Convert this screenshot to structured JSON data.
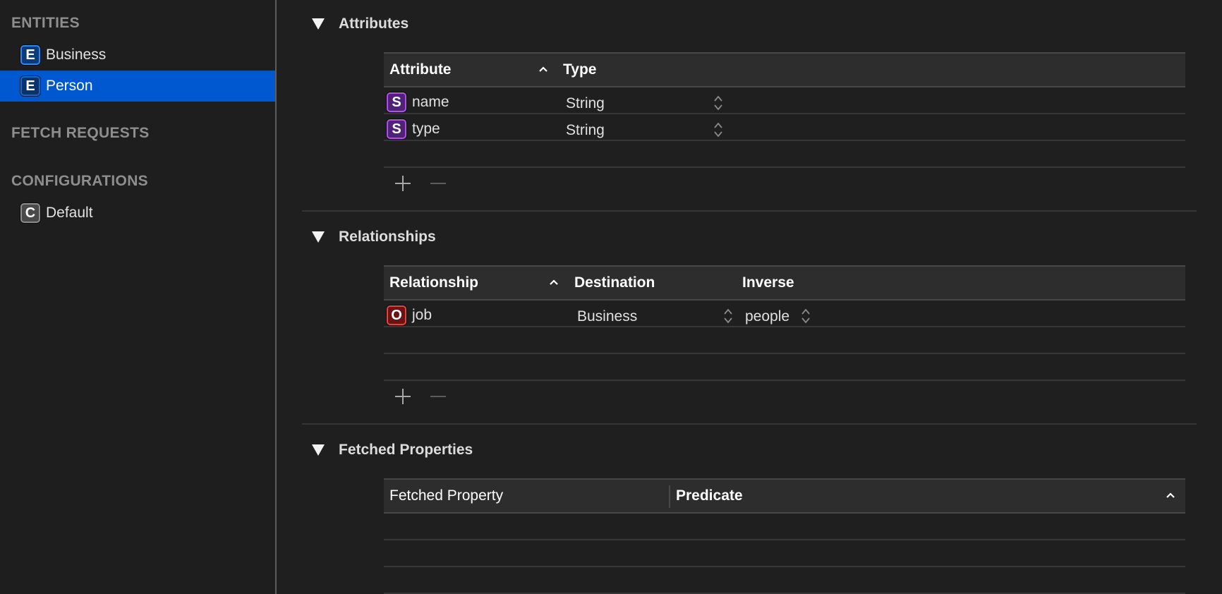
{
  "sidebar": {
    "groups": {
      "entities": "ENTITIES",
      "fetch_requests": "FETCH REQUESTS",
      "configurations": "CONFIGURATIONS"
    },
    "entities": [
      {
        "badge": "E",
        "label": "Business",
        "selected": false
      },
      {
        "badge": "E",
        "label": "Person",
        "selected": true
      }
    ],
    "configurations": [
      {
        "badge": "C",
        "label": "Default"
      }
    ]
  },
  "attributes": {
    "title": "Attributes",
    "columns": {
      "attribute": "Attribute",
      "type": "Type"
    },
    "sort": "ascending",
    "rows": [
      {
        "badge": "S",
        "name": "name",
        "type": "String"
      },
      {
        "badge": "S",
        "name": "type",
        "type": "String"
      }
    ]
  },
  "relationships": {
    "title": "Relationships",
    "columns": {
      "relationship": "Relationship",
      "destination": "Destination",
      "inverse": "Inverse"
    },
    "sort": "ascending",
    "rows": [
      {
        "badge": "O",
        "name": "job",
        "destination": "Business",
        "inverse": "people"
      }
    ]
  },
  "fetched_properties": {
    "title": "Fetched Properties",
    "columns": {
      "fetched_property": "Fetched Property",
      "predicate": "Predicate"
    },
    "sort": "ascending",
    "rows": []
  },
  "colors": {
    "selection": "#0058d1",
    "entity_badge": "#0b3b78",
    "string_badge": "#4f2277",
    "relationship_badge": "#6b1313",
    "background": "#1f1f1f"
  }
}
